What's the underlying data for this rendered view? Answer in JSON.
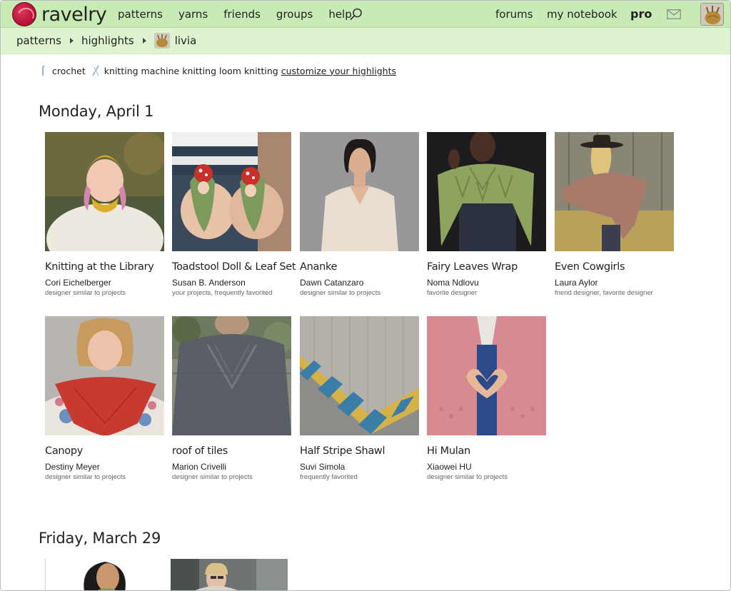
{
  "brand": {
    "name": "ravelry",
    "accent": "#c8eab4",
    "logo_color": "#c0163f"
  },
  "nav": {
    "items": [
      "patterns",
      "yarns",
      "friends",
      "groups",
      "help"
    ],
    "forums": "forums",
    "notebook": "my notebook",
    "pro": "pro"
  },
  "breadcrumb": {
    "patterns": "patterns",
    "highlights": "highlights",
    "user": "livia"
  },
  "filters": {
    "crochet": "crochet",
    "machine": "knitting machine",
    "loom": "knitting loom",
    "knitting": "knitting",
    "customize": "customize your highlights"
  },
  "sections": [
    {
      "date": "Monday, April 1",
      "cards": [
        {
          "title": "Knitting at the Library",
          "designer": "Cori Eichelberger",
          "reason": "designer similar to projects"
        },
        {
          "title": "Toadstool Doll & Leaf Set",
          "designer": "Susan B. Anderson",
          "reason": "your projects, frequently favorited"
        },
        {
          "title": "Ananke",
          "designer": "Dawn Catanzaro",
          "reason": "designer similar to projects"
        },
        {
          "title": "Fairy Leaves Wrap",
          "designer": "Noma Ndlovu",
          "reason": "favorite designer"
        },
        {
          "title": "Even Cowgirls",
          "designer": "Laura Aylor",
          "reason": "friend designer, favorite designer"
        },
        {
          "title": "Canopy",
          "designer": "Destiny Meyer",
          "reason": "designer similar to projects"
        },
        {
          "title": "roof of tiles",
          "designer": "Marion Crivelli",
          "reason": "designer similar to projects"
        },
        {
          "title": "Half Stripe Shawl",
          "designer": "Suvi Simola",
          "reason": "frequently favorited"
        },
        {
          "title": "Hi Mulan",
          "designer": "Xiaowei HU",
          "reason": "designer similar to projects"
        }
      ]
    },
    {
      "date": "Friday, March 29"
    }
  ]
}
